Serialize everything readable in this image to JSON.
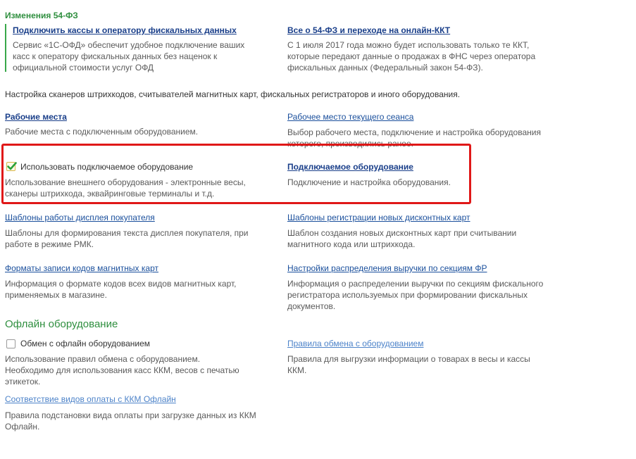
{
  "fz54": {
    "title": "Изменения 54-ФЗ",
    "left_link": "Подключить кассы к оператору фискальных данных",
    "left_desc": [
      "Сервис  «1С-ОФД» обеспечит удобное подключение ваших",
      "касс к оператору фискальных данных без наценок к",
      "официальной стоимости услуг ОФД"
    ],
    "right_link": "Все о 54-ФЗ и переходе на онлайн-ККТ",
    "right_desc": [
      "С 1 июля 2017 года можно будет использовать только те ККТ,",
      "которые передают данные о продажах в ФНС через оператора",
      "фискальных данных (Федеральный закон 54-ФЗ)."
    ]
  },
  "equipment": {
    "intro": "Настройка сканеров штрихкодов, считывателей магнитных карт, фискальных регистраторов и иного оборудования.",
    "workplaces_link": "Рабочие места",
    "workplaces_desc": "Рабочие места с подключенным оборудованием.",
    "current_workplace_link": "Рабочее место текущего сеанса",
    "current_workplace_desc": [
      "Выбор рабочего места, подключение и настройка оборудования",
      "которого, производились ранее."
    ],
    "use_equipment_label": "Использовать подключаемое оборудование",
    "use_equipment_checked": true,
    "use_equipment_desc": [
      "Использование внешнего оборудования - электронные весы,",
      "сканеры штрихкода, эквайринговые терминалы и т.д."
    ],
    "connected_equipment_link": "Подключаемое оборудование",
    "connected_equipment_desc": "Подключение и настройка оборудования.",
    "display_templates_link": "Шаблоны работы дисплея покупателя",
    "display_templates_desc": [
      "Шаблоны для формирования текста дисплея покупателя, при",
      "работе в режиме РМК."
    ],
    "discount_templates_link": "Шаблоны регистрации новых дисконтных карт",
    "discount_templates_desc": [
      "Шаблон создания новых дисконтных карт при считывании",
      "магнитного кода или штрихкода."
    ],
    "magcard_formats_link": "Форматы записи кодов магнитных карт",
    "magcard_formats_desc": [
      "Информация о формате кодов всех видов магнитных карт,",
      "применяемых в магазине."
    ],
    "revenue_link": "Настройки распределения выручки по секциям ФР",
    "revenue_desc": [
      "Информация о распределении выручки по секциям фискального",
      "регистратора используемых при формировании фискальных",
      "документов."
    ]
  },
  "offline": {
    "title": "Офлайн оборудование",
    "exchange_label": "Обмен с офлайн оборудованием",
    "exchange_checked": false,
    "exchange_desc": [
      "Использование правил обмена с оборудованием.",
      "Необходимо для использования касс ККМ, весов с печатью",
      "этикеток."
    ],
    "rules_link": "Правила обмена с оборудованием",
    "rules_desc": [
      "Правила для выгрузки информации о товарах в весы и кассы",
      "ККМ."
    ],
    "payment_link": "Соответствие видов оплаты с ККМ Офлайн",
    "payment_desc": [
      "Правила подстановки вида оплаты при загрузке данных из ККМ",
      "Офлайн."
    ]
  },
  "colors": {
    "section_green": "#2f8f3f",
    "link_blue": "#1a4f9c",
    "highlight_red": "#e01818",
    "check_green": "#2aa13a"
  }
}
